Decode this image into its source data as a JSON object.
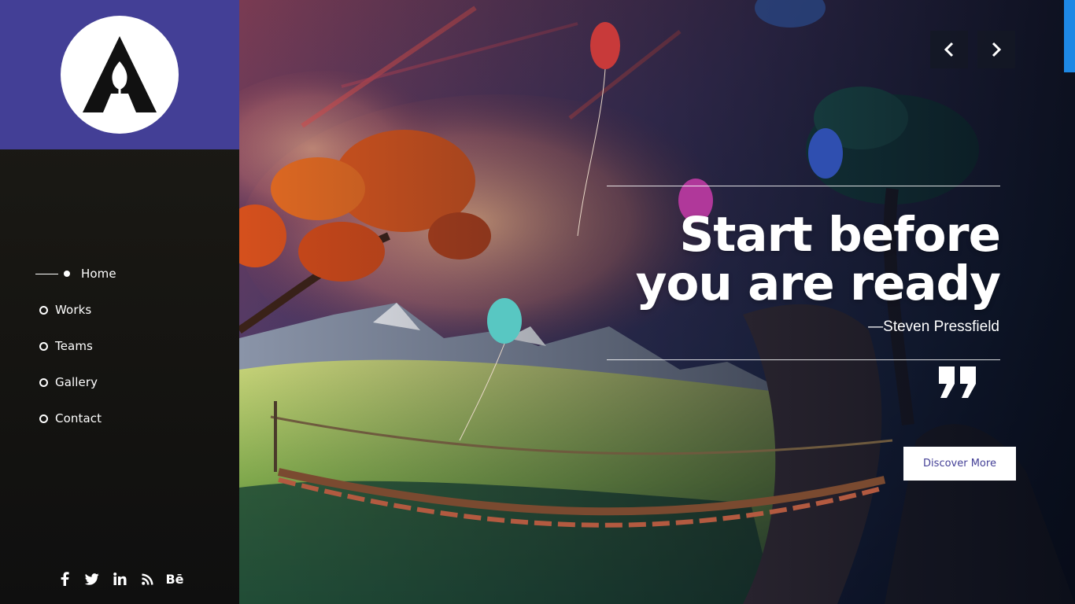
{
  "logo": {
    "icon": "a-letter-logo-icon"
  },
  "nav": {
    "items": [
      {
        "label": "Home",
        "active": true
      },
      {
        "label": "Works",
        "active": false
      },
      {
        "label": "Teams",
        "active": false
      },
      {
        "label": "Gallery",
        "active": false
      },
      {
        "label": "Contact",
        "active": false
      }
    ]
  },
  "socials": [
    {
      "name": "facebook-icon",
      "glyph": "f"
    },
    {
      "name": "twitter-icon",
      "glyph": ""
    },
    {
      "name": "linkedin-icon",
      "glyph": "in"
    },
    {
      "name": "rss-icon",
      "glyph": ""
    },
    {
      "name": "behance-icon",
      "glyph": "Bē"
    }
  ],
  "hero": {
    "headline_line1": "Start before",
    "headline_line2": "you are ready",
    "author": "—Steven Pressfield",
    "cta_label": "Discover More",
    "prev_icon": "chevron-left-icon",
    "next_icon": "chevron-right-icon",
    "quote_icon": "quote-mark-icon"
  },
  "colors": {
    "brand": "#433f96",
    "sidebar_dark": "#171612",
    "text": "#ffffff",
    "scroll_accent": "#1e88e5"
  }
}
